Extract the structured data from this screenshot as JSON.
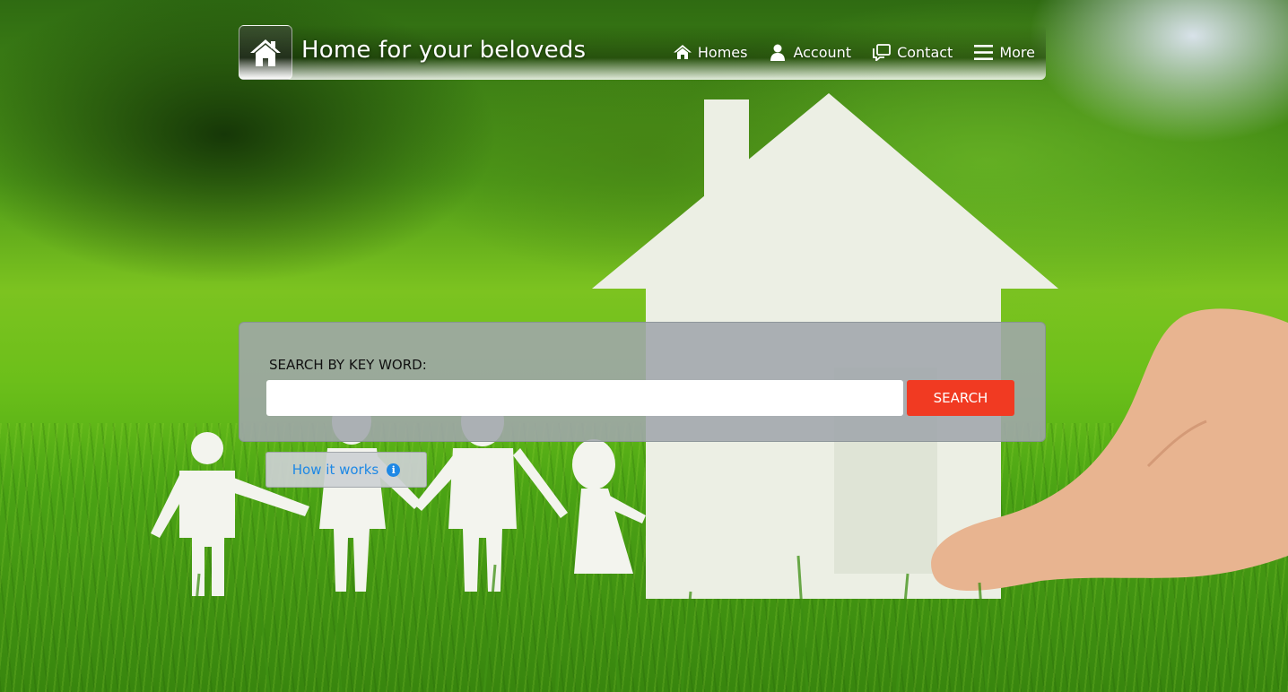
{
  "header": {
    "logo_icon": "house-icon",
    "title": "Home for your beloveds"
  },
  "nav": {
    "items": [
      {
        "label": "Homes",
        "icon": "house-icon"
      },
      {
        "label": "Account",
        "icon": "user-icon"
      },
      {
        "label": "Contact",
        "icon": "chat-icon"
      },
      {
        "label": "More",
        "icon": "menu-icon"
      }
    ]
  },
  "search": {
    "label": "SEARCH BY KEY WORD:",
    "value": "",
    "placeholder": "",
    "button_label": "SEARCH"
  },
  "how_it_works": {
    "label": "How it works",
    "icon": "info-icon",
    "icon_glyph": "i"
  },
  "colors": {
    "search_button": "#f13a22",
    "link_blue": "#1e88e5",
    "panel": "#a0a6ac"
  }
}
